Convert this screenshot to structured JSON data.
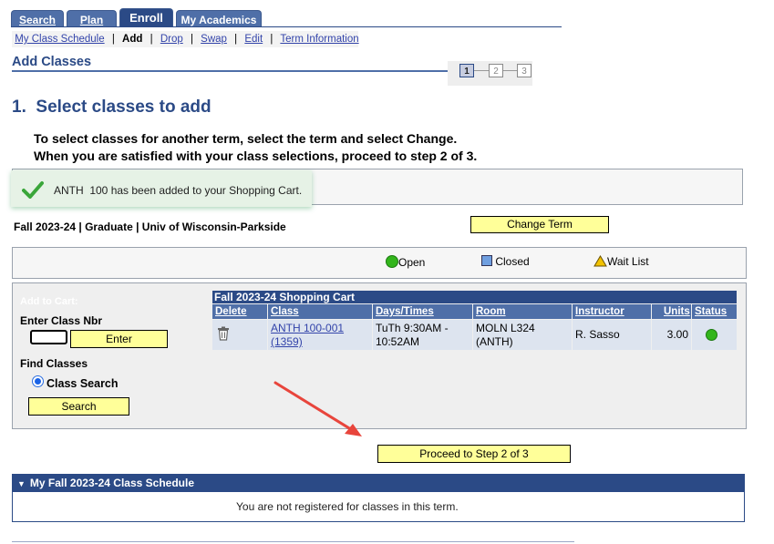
{
  "tabs": [
    {
      "label": "Search"
    },
    {
      "label": "Plan"
    },
    {
      "label": "Enroll"
    },
    {
      "label": "My Academics"
    }
  ],
  "subnav": {
    "items": [
      "My Class Schedule",
      "Add",
      "Drop",
      "Swap",
      "Edit",
      "Term Information"
    ],
    "separator": "|"
  },
  "page_title": "Add Classes",
  "steps": [
    "1",
    "2",
    "3"
  ],
  "heading": "1.  Select classes to add",
  "instructions": {
    "line1": "To select classes for another term, select the term and select Change.",
    "line2": "When you are satisfied with your class selections, proceed to step 2 of 3."
  },
  "confirmation": {
    "icon": "checkmark-icon",
    "message": "ANTH  100 has been added to your Shopping Cart.",
    "color": "#3aa63a"
  },
  "term": {
    "info": "Fall 2023-24 | Graduate | Univ of Wisconsin-Parkside",
    "change_label": "Change Term"
  },
  "legend": {
    "open": "Open",
    "closed": "Closed",
    "waitlist": "Wait List"
  },
  "add_to_cart": {
    "label": "Add to Cart:",
    "enter_class_nbr_label": "Enter Class Nbr",
    "class_nbr_value": "",
    "enter_button": "Enter",
    "find_classes_label": "Find Classes",
    "class_search_option": "Class Search",
    "search_button": "Search"
  },
  "cart": {
    "title": "Fall 2023-24 Shopping Cart",
    "columns": [
      "Delete",
      "Class",
      "Days/Times",
      "Room",
      "Instructor",
      "Units",
      "Status"
    ],
    "row": {
      "class_line1": "ANTH 100-001",
      "class_line2": "(1359)",
      "days_line1": "TuTh 9:30AM -",
      "days_line2": "10:52AM",
      "room_line1": "MOLN L324",
      "room_line2": "(ANTH)",
      "instructor": "R. Sasso",
      "units": "3.00",
      "status_icon": "open-status-icon"
    }
  },
  "proceed_button": "Proceed to Step 2 of 3",
  "schedule": {
    "header": "My Fall 2023-24 Class Schedule",
    "message": "You are not registered for classes in this term."
  },
  "colors": {
    "brand": "#2b4a86",
    "button": "#ffff99",
    "arrow": "#e8453c"
  }
}
